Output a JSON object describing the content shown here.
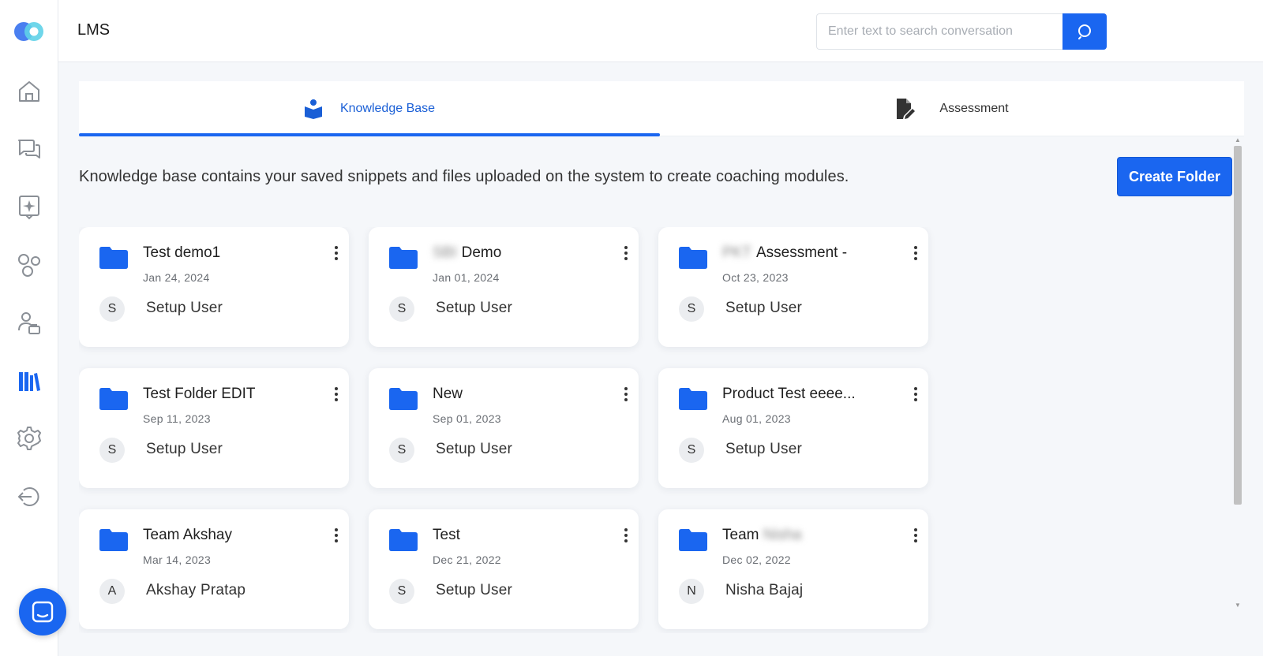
{
  "app": {
    "title": "LMS"
  },
  "search": {
    "placeholder": "Enter text to search conversation"
  },
  "tabs": [
    {
      "label": "Knowledge Base",
      "icon": "book-reader-icon",
      "active": true
    },
    {
      "label": "Assessment",
      "icon": "document-edit-icon",
      "active": false
    }
  ],
  "description": "Knowledge base contains your saved snippets and files uploaded on the system to create coaching modules.",
  "create_button": "Create Folder",
  "folders": [
    {
      "title": "Test demo1",
      "date": "Jan 24, 2024",
      "initial": "S",
      "owner": "Setup User"
    },
    {
      "title_hidden": "SBI",
      "title": "Demo",
      "date": "Jan 01, 2024",
      "initial": "S",
      "owner": "Setup User"
    },
    {
      "title_hidden": "PKT",
      "title": "Assessment -",
      "date": "Oct 23, 2023",
      "initial": "S",
      "owner": "Setup User"
    },
    {
      "title": "Test Folder EDIT",
      "date": "Sep 11, 2023",
      "initial": "S",
      "owner": "Setup User"
    },
    {
      "title": "New",
      "date": "Sep 01, 2023",
      "initial": "S",
      "owner": "Setup User"
    },
    {
      "title": "Product Test eeee...",
      "date": "Aug 01, 2023",
      "initial": "S",
      "owner": "Setup User"
    },
    {
      "title": "Team Akshay",
      "date": "Mar 14, 2023",
      "initial": "A",
      "owner": "Akshay Pratap"
    },
    {
      "title": "Test",
      "date": "Dec 21, 2022",
      "initial": "S",
      "owner": "Setup User"
    },
    {
      "title": "Team",
      "title_hidden_after": "Nisha",
      "date": "Dec 02, 2022",
      "initial": "N",
      "owner": "Nisha Bajaj"
    }
  ],
  "sidebar": [
    "home-icon",
    "conversations-icon",
    "insights-icon",
    "topics-icon",
    "users-icon",
    "library-icon",
    "settings-icon",
    "logout-icon"
  ],
  "colors": {
    "accent": "#1a66f0",
    "folder": "#1a66f0",
    "sidebar_icon": "#8a8f96"
  }
}
